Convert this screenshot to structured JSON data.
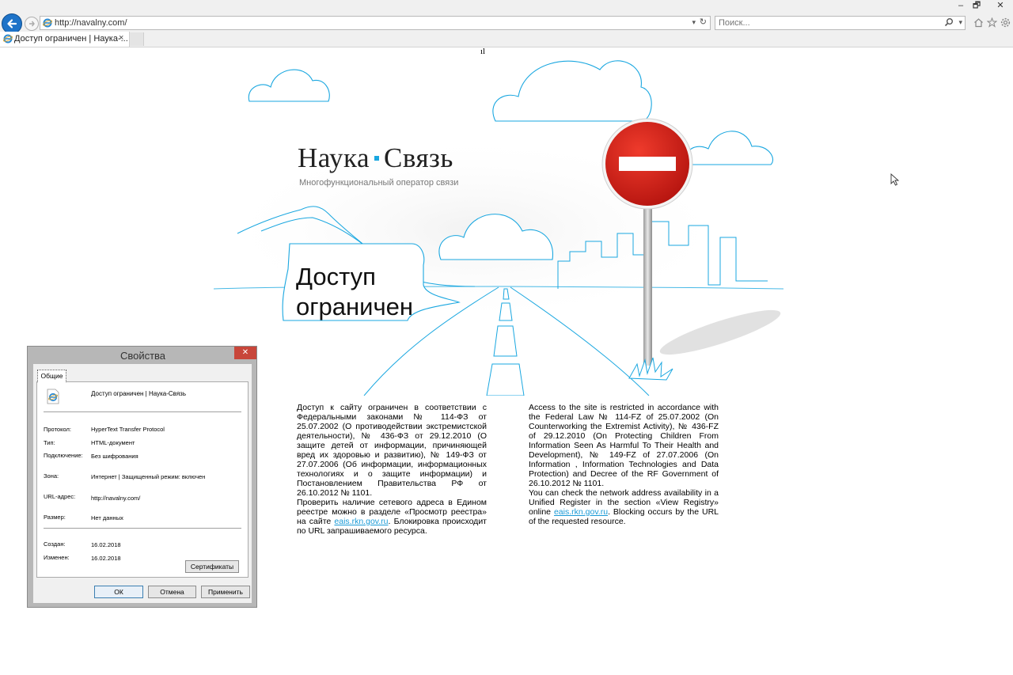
{
  "browser": {
    "address": "http://navalny.com/",
    "search_placeholder": "Поиск...",
    "tab_title": "Доступ ограничен | Наука-...",
    "tab_close": "×",
    "win_minimize": "–",
    "win_restore": "🗗",
    "win_close": "✕",
    "icons": [
      "back-icon",
      "forward-icon",
      "ie-icon",
      "refresh-icon",
      "search-icon",
      "home-icon",
      "star-icon",
      "gear-icon"
    ]
  },
  "page": {
    "stray_text": "ıl",
    "logo_part1": "Наука",
    "logo_part2": "Связь",
    "subtitle": "Многофункциональный оператор связи",
    "heading_line1": "Доступ",
    "heading_line2": "ограничен",
    "ru_p1": "Доступ к сайту ограничен в соответствии с Федеральными законами № 114-ФЗ от 25.07.2002 (О противодействии экстремистской деятельности), № 436-ФЗ от 29.12.2010 (О защите детей от информации, причиняющей вред их здоровью и развитию), № 149-ФЗ от 27.07.2006 (Об информации, информационных технологиях и о защите информации) и Постановлением Правительства РФ от 26.10.2012 № 1101.",
    "ru_p2_a": "Проверить наличие сетевого адреса в Едином реестре можно в разделе «Просмотр реестра» на сайте ",
    "ru_link": "eais.rkn.gov.ru",
    "ru_p2_b": ". Блокировка происходит по URL запрашиваемого ресурса.",
    "en_p1": "Access to the site is restricted in accordance with the Federal Law № 114-FZ of 25.07.2002 (On Counterworking the Extremist Activity), № 436-FZ of 29.12.2010 (On Protecting Children From Information Seen As Harmful To Their Health and Development), № 149-FZ of 27.07.2006 (On Information , Information Technologies and Data Protection) and Decree of the RF Government of 26.10.2012 № 1101.",
    "en_p2_a": "You can check the network address availability in a Unified Register in the section «View Registry» online ",
    "en_link": "eais.rkn.gov.ru",
    "en_p2_b": ". Blocking occurs by the URL of the requested resource."
  },
  "dialog": {
    "title": "Свойства",
    "close": "✕",
    "tab_general": "Общие",
    "name": "Доступ ограничен | Наука-Связь",
    "protocol_label": "Протокол:",
    "protocol_value": "HyperText Transfer Protocol",
    "type_label": "Тип:",
    "type_value": "HTML-документ",
    "connection_label": "Подключение:",
    "connection_value": "Без шифрования",
    "zone_label": "Зона:",
    "zone_value": "Интернет | Защищенный режим: включен",
    "url_label": "URL-адрес:",
    "url_value": "http://navalny.com/",
    "size_label": "Размер:",
    "size_value": "Нет данных",
    "created_label": "Создан:",
    "created_value": "16.02.2018",
    "modified_label": "Изменен:",
    "modified_value": "16.02.2018",
    "certificates_button": "Сертификаты",
    "ok_button": "ОК",
    "cancel_button": "Отмена",
    "apply_button": "Применить"
  },
  "colors": {
    "accent": "#1aa7e0",
    "sign_red": "#d8261f",
    "ie_blue": "#1e73c8"
  }
}
